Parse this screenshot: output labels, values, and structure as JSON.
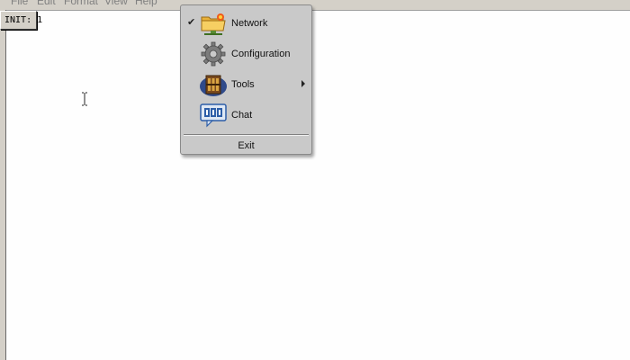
{
  "menubar": {
    "items": [
      "File",
      "Edit",
      "Format",
      "View",
      "Help"
    ]
  },
  "status": {
    "init_label": "INIT: 1"
  },
  "context_menu": {
    "items": [
      {
        "label": "Network",
        "icon": "network-folder-icon",
        "checked": true,
        "submenu": false
      },
      {
        "label": "Configuration",
        "icon": "gear-icon",
        "checked": false,
        "submenu": false
      },
      {
        "label": "Tools",
        "icon": "toolbox-icon",
        "checked": false,
        "submenu": true
      },
      {
        "label": "Chat",
        "icon": "chat-bubble-icon",
        "checked": false,
        "submenu": false
      }
    ],
    "exit_label": "Exit"
  }
}
